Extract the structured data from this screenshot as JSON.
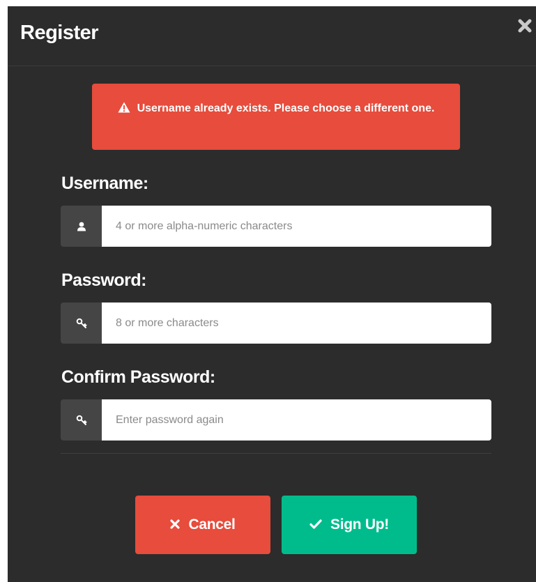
{
  "modal": {
    "title": "Register"
  },
  "alert": {
    "message": "Username already exists. Please choose a different one.",
    "icon": "warning-icon",
    "color": "#e74c3c"
  },
  "form": {
    "username": {
      "label": "Username:",
      "placeholder": "4 or more alpha-numeric characters",
      "value": "",
      "icon": "user-icon"
    },
    "password": {
      "label": "Password:",
      "placeholder": "8 or more characters",
      "value": "",
      "icon": "key-icon"
    },
    "confirm_password": {
      "label": "Confirm Password:",
      "placeholder": "Enter password again",
      "value": "",
      "icon": "key-icon"
    }
  },
  "buttons": {
    "cancel_label": "Cancel",
    "cancel_icon": "times-icon",
    "cancel_color": "#e74c3c",
    "signup_label": "Sign Up!",
    "signup_icon": "check-icon",
    "signup_color": "#00bc8c"
  },
  "colors": {
    "modal_background": "#2c2c2c",
    "addon_background": "#464545"
  }
}
